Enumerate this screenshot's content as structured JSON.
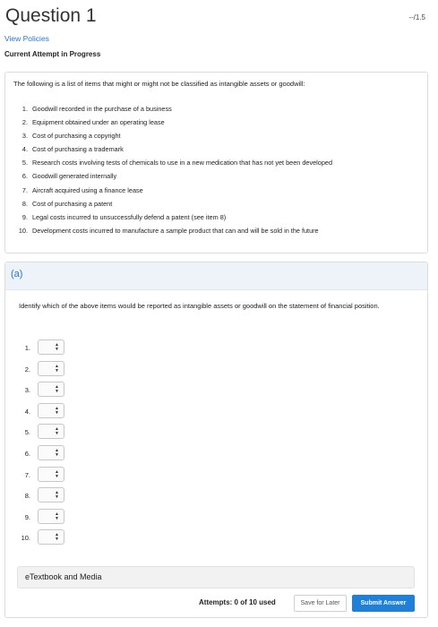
{
  "header": {
    "title": "Question 1",
    "score": "--/1.5",
    "view_policies": "View Policies",
    "attempt_status": "Current Attempt in Progress"
  },
  "question": {
    "intro": "The following is a list of items that might or might not be classified as intangible assets or goodwill:",
    "items": [
      {
        "num": "1.",
        "text": "Goodwill recorded in the purchase of a business"
      },
      {
        "num": "2.",
        "text": "Equipment obtained under an operating lease"
      },
      {
        "num": "3.",
        "text": "Cost of purchasing a copyright"
      },
      {
        "num": "4.",
        "text": "Cost of purchasing a trademark"
      },
      {
        "num": "5.",
        "text": "Research costs involving tests of chemicals to use in a new medication that has not yet been developed"
      },
      {
        "num": "6.",
        "text": "Goodwill generated internally"
      },
      {
        "num": "7.",
        "text": "Aircraft acquired using a finance lease"
      },
      {
        "num": "8.",
        "text": "Cost of purchasing a patent"
      },
      {
        "num": "9.",
        "text": "Legal costs incurred to unsuccessfully defend a patent (see item 8)"
      },
      {
        "num": "10.",
        "text": "Development costs incurred to manufacture a sample product that can and will be sold in the future"
      }
    ]
  },
  "part_a": {
    "label": "(a)",
    "instruction": "Identify which of the above items would be reported as intangible assets or goodwill on the statement of financial position.",
    "rows": [
      {
        "num": "1.",
        "value": ""
      },
      {
        "num": "2.",
        "value": ""
      },
      {
        "num": "3.",
        "value": ""
      },
      {
        "num": "4.",
        "value": ""
      },
      {
        "num": "5.",
        "value": ""
      },
      {
        "num": "6.",
        "value": ""
      },
      {
        "num": "7.",
        "value": ""
      },
      {
        "num": "8.",
        "value": ""
      },
      {
        "num": "9.",
        "value": ""
      },
      {
        "num": "10.",
        "value": ""
      }
    ],
    "select_arrow_icon": "up-down-arrows-icon"
  },
  "footer": {
    "etextbook": "eTextbook and Media",
    "attempts": "Attempts: 0 of 10 used",
    "save_label": "Save for Later",
    "submit_label": "Submit Answer"
  },
  "colors": {
    "link": "#2a75c9",
    "submit_bg": "#1e80d8",
    "part_header_bg": "#eef3fa"
  }
}
